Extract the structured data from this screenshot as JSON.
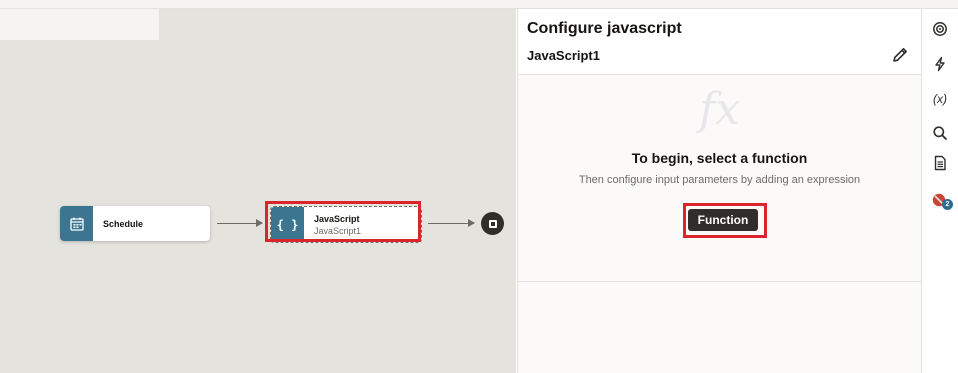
{
  "flow": {
    "nodes": [
      {
        "title": "Schedule",
        "icon": "calendar-icon"
      },
      {
        "title": "JavaScript",
        "subtitle": "JavaScript1",
        "icon": "braces-icon",
        "selected": true
      }
    ],
    "end_icon": "stop-icon"
  },
  "panel": {
    "title": "Configure javascript",
    "subtitle": "JavaScript1",
    "edit_icon": "pencil-icon",
    "fx_mark": "fx",
    "empty_title": "To begin, select a function",
    "empty_subtitle": "Then configure input parameters by adding an expression",
    "function_button": "Function"
  },
  "rail": {
    "items": [
      {
        "icon": "target-icon"
      },
      {
        "icon": "lightning-icon"
      },
      {
        "icon": "variable-icon",
        "label": "(x)"
      },
      {
        "icon": "search-icon"
      },
      {
        "icon": "document-icon"
      },
      {
        "icon": "error-icon",
        "badge": "2"
      }
    ]
  },
  "colors": {
    "node_accent": "#3b7590",
    "highlight": "#d9262d",
    "button": "#312d2a",
    "canvas": "#e5e3de"
  }
}
